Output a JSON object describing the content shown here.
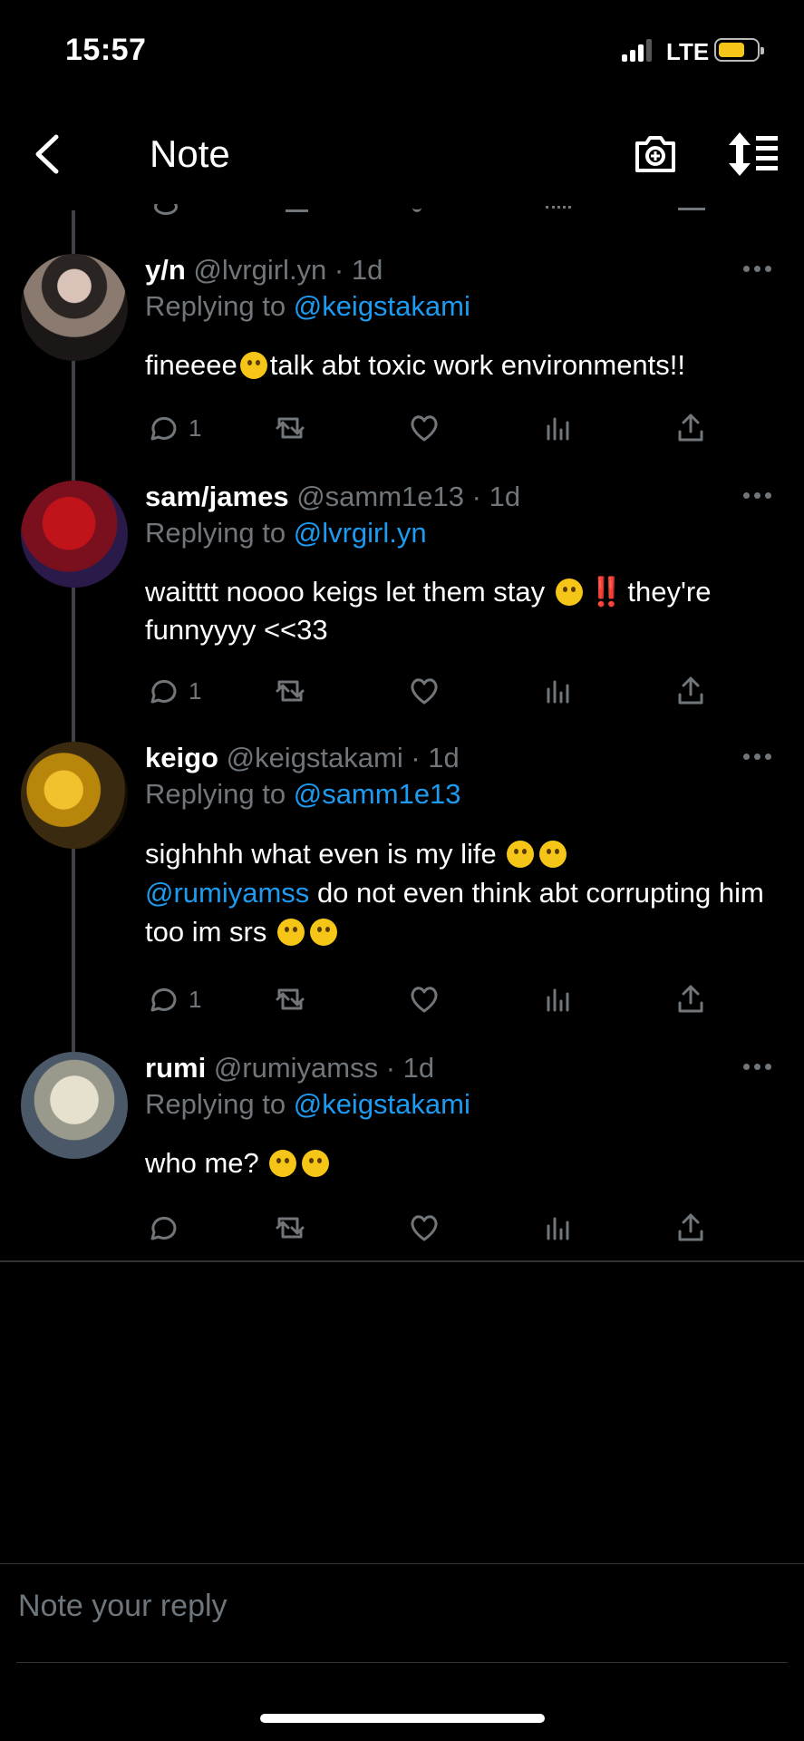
{
  "status_bar": {
    "time": "15:57",
    "network": "LTE"
  },
  "header": {
    "title": "Note"
  },
  "tweets": [
    {
      "name": "y/n",
      "handle": "@lvrgirl.yn",
      "age": "· 1d",
      "replying_label": "Replying to",
      "replying_to": "@keigstakami",
      "text_a": "fineeee",
      "text_b": "talk abt toxic work environments!!",
      "reply_count": "1"
    },
    {
      "name": "sam/james",
      "handle": "@samm1e13",
      "age": "· 1d",
      "replying_label": "Replying to",
      "replying_to": "@lvrgirl.yn",
      "text_a": "waitttt noooo keigs let them stay",
      "bangs": "‼️",
      "text_b": "they're funnyyyy <<33",
      "reply_count": "1"
    },
    {
      "name": "keigo",
      "handle": "@keigstakami",
      "age": "· 1d",
      "replying_label": "Replying to",
      "replying_to": "@samm1e13",
      "text_a": "sighhhh what even is my life",
      "mention": "@rumiyamss",
      "text_b": "do not even think abt corrupting him too im srs",
      "reply_count": "1"
    },
    {
      "name": "rumi",
      "handle": "@rumiyamss",
      "age": "· 1d",
      "replying_label": "Replying to",
      "replying_to": "@keigstakami",
      "text_a": "who me?",
      "reply_count": ""
    }
  ],
  "reply_box": {
    "placeholder": "Note your reply"
  },
  "colors": {
    "accent": "#1d9bf0",
    "muted": "#71767b",
    "background": "#000000"
  }
}
